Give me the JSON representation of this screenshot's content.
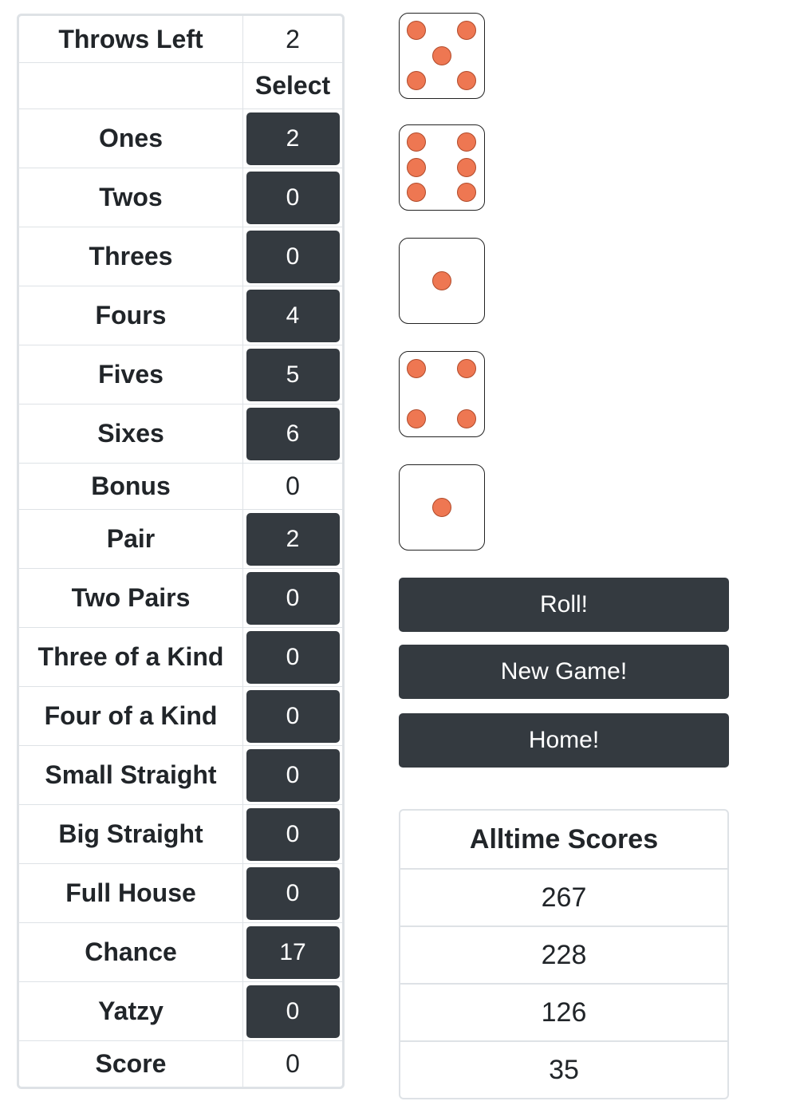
{
  "scoreboard": {
    "throws_left_label": "Throws Left",
    "throws_left_value": "2",
    "select_label": "Select",
    "categories": [
      {
        "label": "Ones",
        "value": "2"
      },
      {
        "label": "Twos",
        "value": "0"
      },
      {
        "label": "Threes",
        "value": "0"
      },
      {
        "label": "Fours",
        "value": "4"
      },
      {
        "label": "Fives",
        "value": "5"
      },
      {
        "label": "Sixes",
        "value": "6"
      }
    ],
    "bonus": {
      "label": "Bonus",
      "value": "0"
    },
    "combos": [
      {
        "label": "Pair",
        "value": "2"
      },
      {
        "label": "Two Pairs",
        "value": "0"
      },
      {
        "label": "Three of a Kind",
        "value": "0"
      },
      {
        "label": "Four of a Kind",
        "value": "0"
      },
      {
        "label": "Small Straight",
        "value": "0"
      },
      {
        "label": "Big Straight",
        "value": "0"
      },
      {
        "label": "Full House",
        "value": "0"
      },
      {
        "label": "Chance",
        "value": "17"
      },
      {
        "label": "Yatzy",
        "value": "0"
      }
    ],
    "score": {
      "label": "Score",
      "value": "0"
    }
  },
  "dice": [
    5,
    6,
    1,
    4,
    1
  ],
  "pip_color": "#ee7752",
  "actions": {
    "roll": "Roll!",
    "new_game": "New Game!",
    "home": "Home!"
  },
  "alltime": {
    "title": "Alltime Scores",
    "scores": [
      "267",
      "228",
      "126",
      "35"
    ]
  }
}
